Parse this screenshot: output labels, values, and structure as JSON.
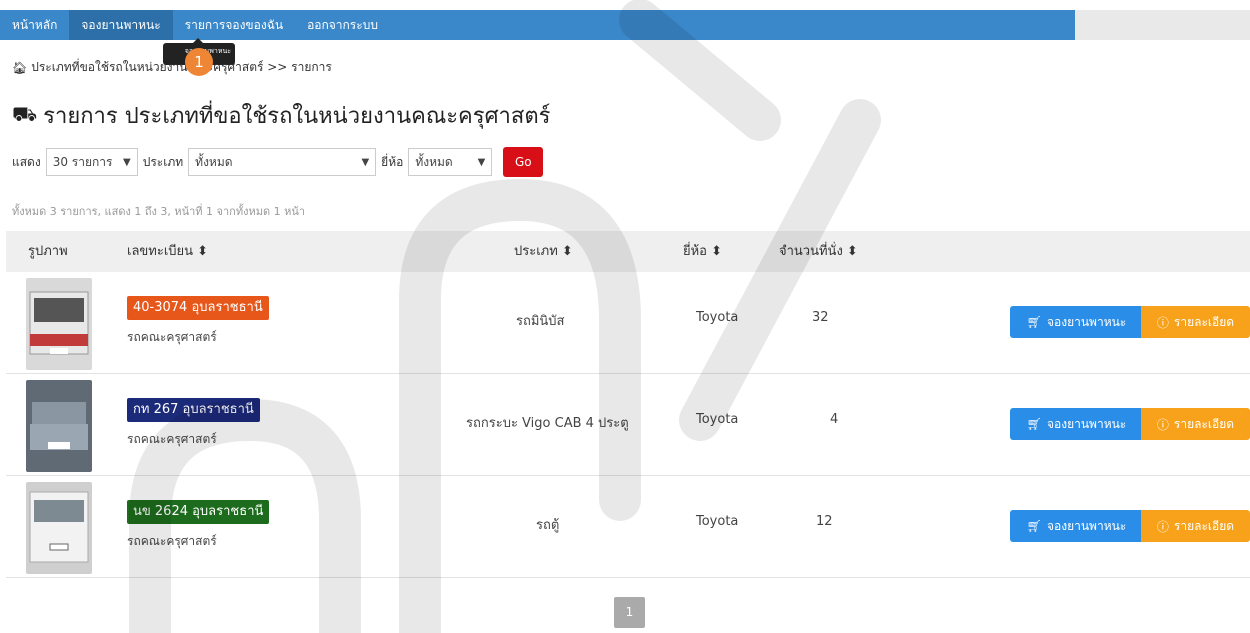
{
  "nav": {
    "items": [
      "หน้าหลัก",
      "จองยานพาหนะ",
      "รายการจองของฉัน",
      "ออกจากระบบ"
    ]
  },
  "tooltip": "จองยานพาหนะ",
  "step_badge": "1",
  "breadcrumb": "ประเภทที่ขอใช้รถในหน่วยงานคณะครุศาสตร์ >> รายการ",
  "page_title": "รายการ ประเภทที่ขอใช้รถในหน่วยงานคณะครุศาสตร์",
  "filters": {
    "show_label": "แสดง",
    "show_value": "30 รายการ",
    "type_label": "ประเภท",
    "type_value": "ทั้งหมด",
    "brand_label": "ยี่ห้อ",
    "brand_value": "ทั้งหมด",
    "go_label": "Go"
  },
  "summary": "ทั้งหมด 3 รายการ, แสดง 1 ถึง 3, หน้าที่ 1 จากทั้งหมด 1 หน้า",
  "table": {
    "headers": {
      "image": "รูปภาพ",
      "plate": "เลขทะเบียน ⬍",
      "type": "ประเภท ⬍",
      "brand": "ยี่ห้อ ⬍",
      "seats": "จำนวนที่นั่ง ⬍"
    },
    "rows": [
      {
        "plate": "40-3074 อุบลราชธานี",
        "plate_color": "#e8571a",
        "dept": "รถคณะครุศาสตร์",
        "type": "รถมินิบัส",
        "brand": "Toyota",
        "seats": "32"
      },
      {
        "plate": "กท 267 อุบลราชธานี",
        "plate_color": "#1c2a7a",
        "dept": "รถคณะครุศาสตร์",
        "type": "รถกระบะ Vigo CAB 4 ประตู",
        "brand": "Toyota",
        "seats": "4"
      },
      {
        "plate": "นข 2624 อุบลราชธานี",
        "plate_color": "#1d6b1d",
        "dept": "รถคณะครุศาสตร์",
        "type": "รถตู้",
        "brand": "Toyota",
        "seats": "12"
      }
    ],
    "book_label": "จองยานพาหนะ",
    "detail_label": "รายละเอียด"
  },
  "pagination": "1",
  "colors": {
    "nav": "#3a87c9",
    "go": "#d80f16",
    "book": "#2a8ee8",
    "detail": "#f7a21a",
    "badge": "#ef8636"
  }
}
